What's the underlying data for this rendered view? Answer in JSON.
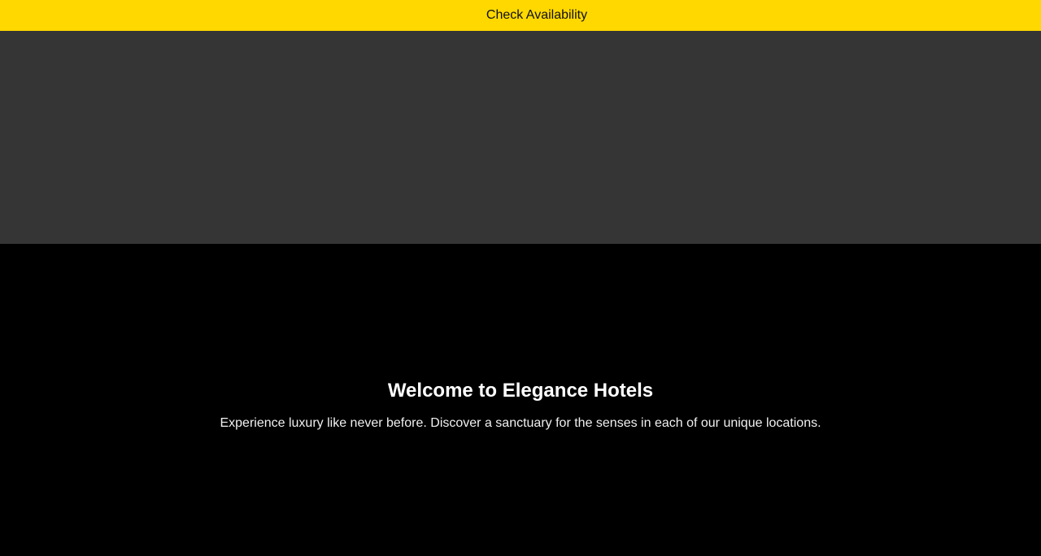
{
  "top_bar": {
    "label": "Check Availability",
    "background": "#FFD800"
  },
  "banner": {
    "background": "#353535"
  },
  "hero": {
    "title": "Welcome to Elegance Hotels",
    "text": "Experience luxury like never before. Discover a sanctuary for the senses in each of our unique locations.",
    "background": "#000000"
  }
}
